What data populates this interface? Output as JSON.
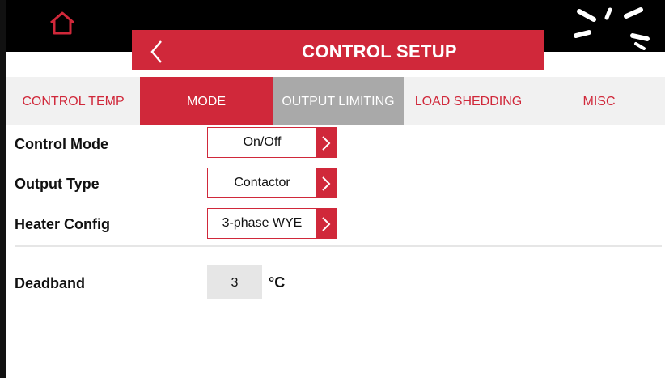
{
  "header": {
    "title": "CONTROL SETUP"
  },
  "tabs": [
    {
      "label": "CONTROL TEMP",
      "state": "normal"
    },
    {
      "label": "MODE",
      "state": "active"
    },
    {
      "label": "OUTPUT LIMITING",
      "state": "disabled"
    },
    {
      "label": "LOAD SHEDDING",
      "state": "normal"
    },
    {
      "label": "MISC",
      "state": "normal"
    }
  ],
  "settings": {
    "control_mode": {
      "label": "Control Mode",
      "value": "On/Off"
    },
    "output_type": {
      "label": "Output Type",
      "value": "Contactor"
    },
    "heater_config": {
      "label": "Heater Config",
      "value": "3-phase WYE"
    },
    "deadband": {
      "label": "Deadband",
      "value": "3",
      "unit": "°C"
    }
  },
  "colors": {
    "accent": "#d0283a",
    "topbar": "#000000",
    "tab_bg": "#f1f1f1",
    "disabled": "#a9a9a9"
  },
  "icons": {
    "home": "home-icon",
    "back": "chevron-left-icon",
    "busy": "spinner-icon",
    "select_arrow": "chevron-right-icon"
  }
}
